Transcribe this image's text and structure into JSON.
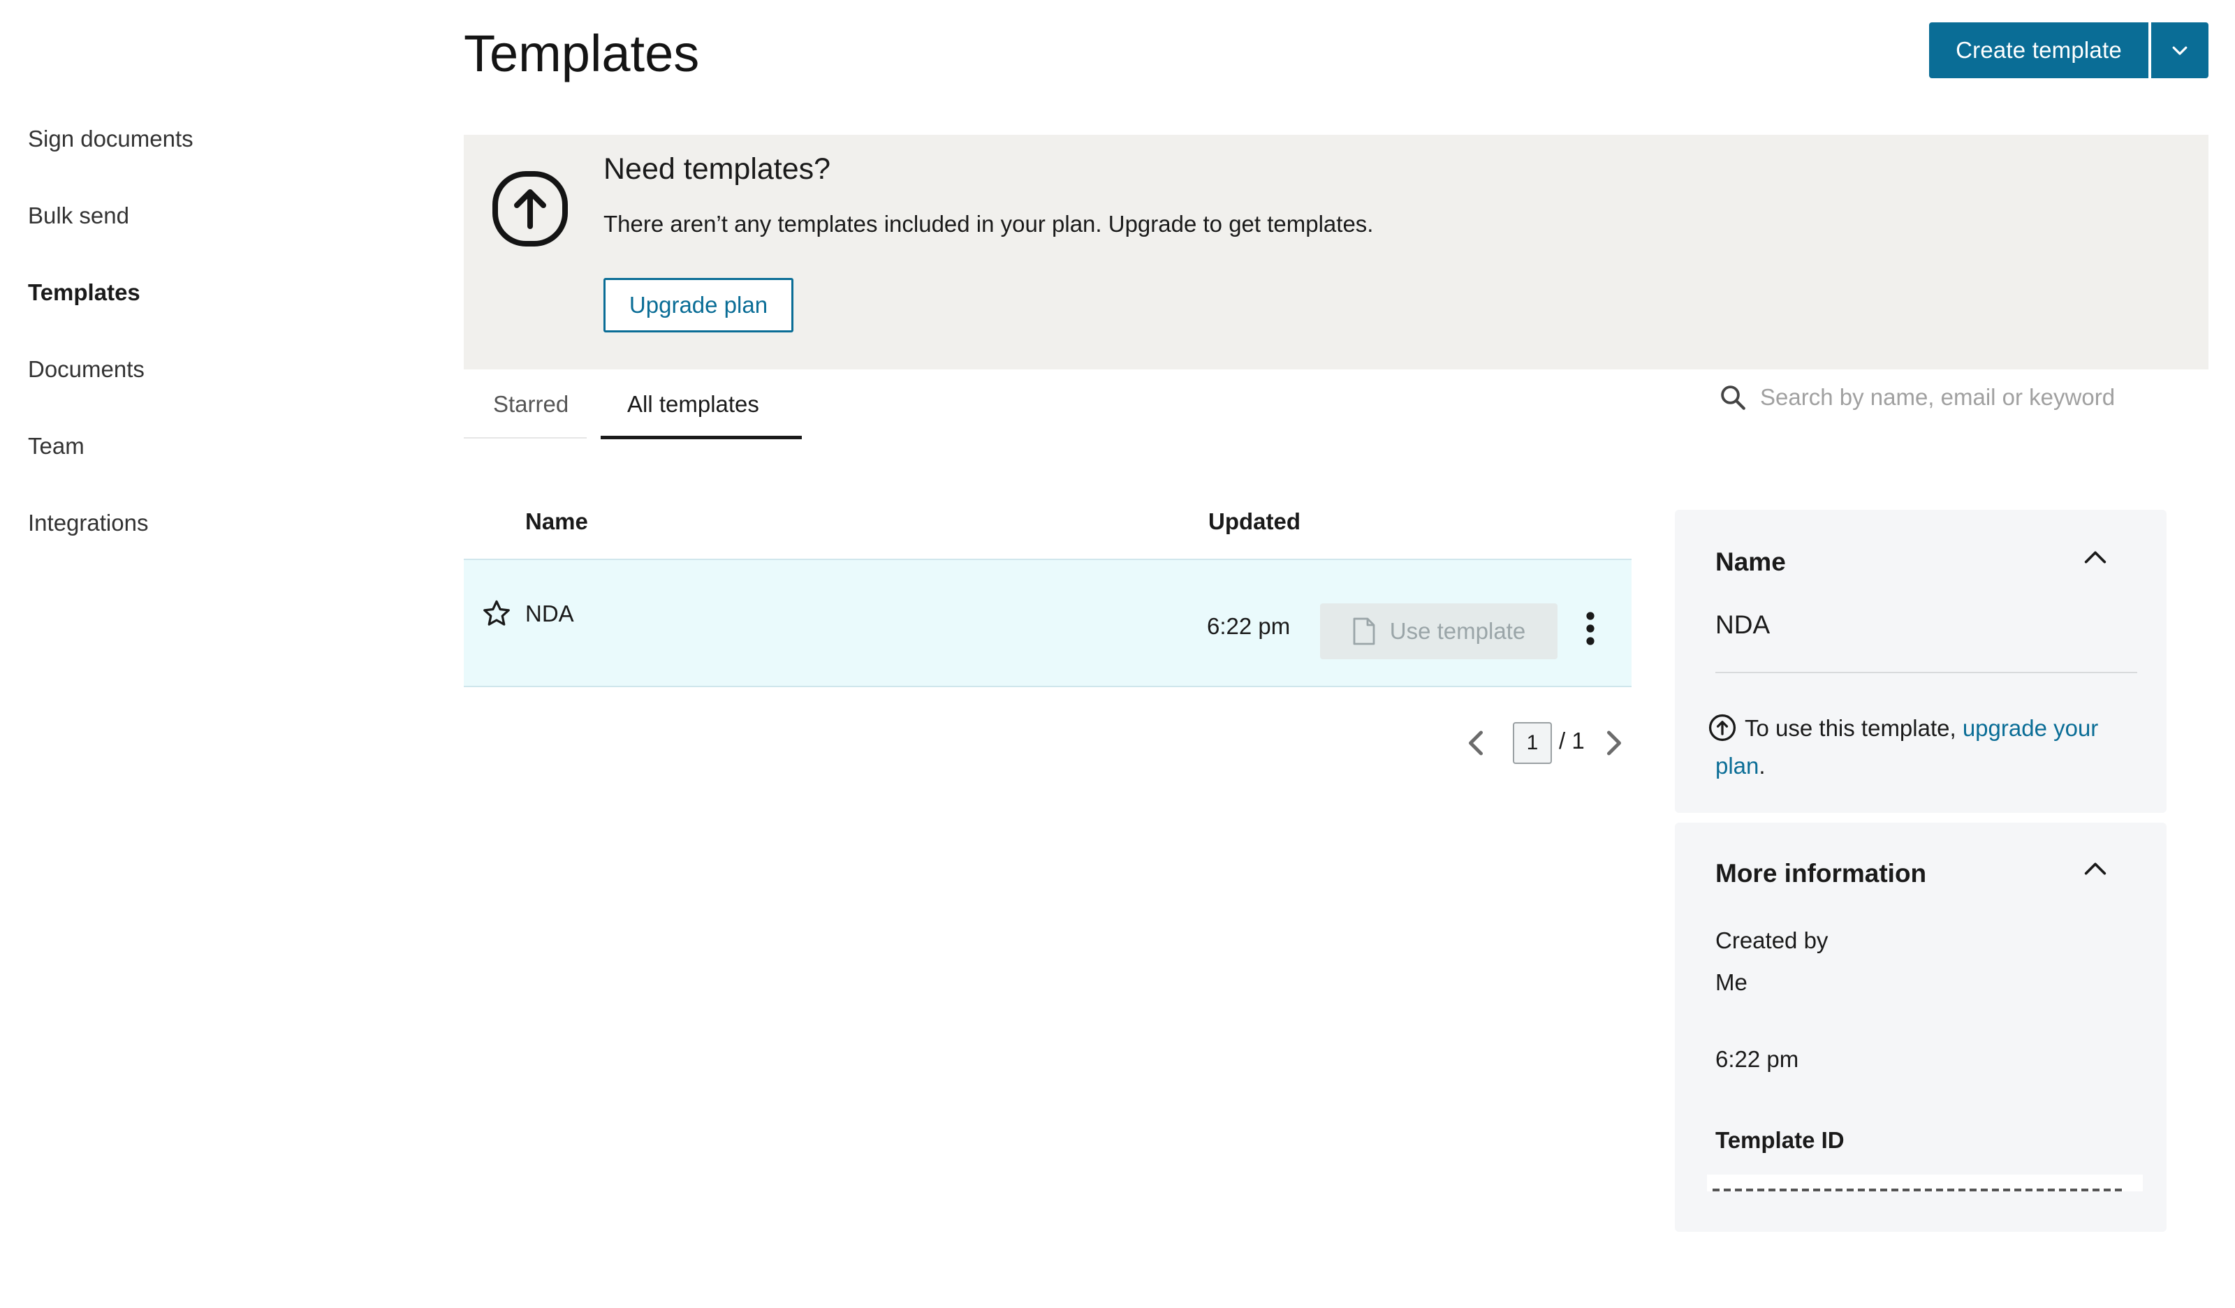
{
  "sidebar": {
    "items": [
      {
        "label": "Sign documents"
      },
      {
        "label": "Bulk send"
      },
      {
        "label": "Templates"
      },
      {
        "label": "Documents"
      },
      {
        "label": "Team"
      },
      {
        "label": "Integrations"
      }
    ],
    "active_item": "Templates"
  },
  "header": {
    "title": "Templates",
    "create_label": "Create template"
  },
  "banner": {
    "title": "Need templates?",
    "text": "There aren’t any templates included in your plan. Upgrade to get templates.",
    "button_label": "Upgrade plan"
  },
  "tabs": [
    {
      "label": "Starred"
    },
    {
      "label": "All templates"
    }
  ],
  "active_tab": "All templates",
  "search": {
    "placeholder": "Search by name, email or keyword"
  },
  "table": {
    "columns": [
      "Name",
      "Updated"
    ],
    "rows": [
      {
        "name": "NDA",
        "updated": "6:22 pm",
        "action_label": "Use template"
      }
    ]
  },
  "pagination": {
    "current": "1",
    "total_text": "/ 1"
  },
  "details": {
    "name_section": {
      "heading": "Name",
      "value": "NDA",
      "notice_prefix": "To use this template,",
      "notice_link_line1": "upgrade your",
      "notice_link_line2": "plan",
      "notice_suffix": "."
    },
    "more_info": {
      "heading": "More information",
      "created_by_label": "Created by",
      "created_by_value": "Me",
      "updated_value": "6:22 pm",
      "template_id_label": "Template ID"
    }
  },
  "colors": {
    "accent": "#0a6d96",
    "banner_bg": "#f1f0ed",
    "row_highlight": "#eafafc",
    "panel_bg": "#f5f6f8"
  },
  "icons": [
    "upload-arrow-icon",
    "chevron-down-icon",
    "search-icon",
    "star-icon",
    "document-icon",
    "more-vertical-icon",
    "chevron-left-icon",
    "chevron-right-icon",
    "chevron-up-icon"
  ]
}
